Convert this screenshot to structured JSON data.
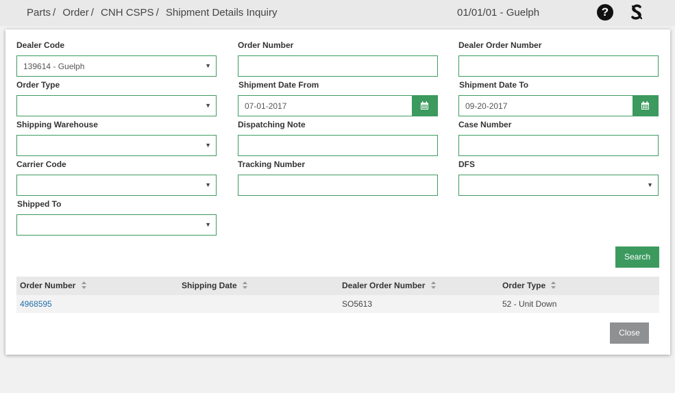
{
  "header": {
    "breadcrumb": [
      "Parts",
      "Order",
      "CNH CSPS",
      "Shipment Details Inquiry"
    ],
    "breadcrumb_separator": "/",
    "dealer_context": "01/01/01 - Guelph",
    "help_icon": "question-circle-icon",
    "brand_icon": "s-logo-icon"
  },
  "form": {
    "dealer_code": {
      "label": "Dealer Code",
      "value": "139614 - Guelph"
    },
    "order_number": {
      "label": "Order Number",
      "value": ""
    },
    "dealer_order_number": {
      "label": "Dealer Order Number",
      "value": ""
    },
    "order_type": {
      "label": "Order Type",
      "value": ""
    },
    "shipment_date_from": {
      "label": "Shipment Date From",
      "value": "07-01-2017"
    },
    "shipment_date_to": {
      "label": "Shipment Date To",
      "value": "09-20-2017"
    },
    "shipping_warehouse": {
      "label": "Shipping Warehouse",
      "value": ""
    },
    "dispatching_note": {
      "label": "Dispatching Note",
      "value": ""
    },
    "case_number": {
      "label": "Case Number",
      "value": ""
    },
    "carrier_code": {
      "label": "Carrier Code",
      "value": ""
    },
    "tracking_number": {
      "label": "Tracking Number",
      "value": ""
    },
    "dfs": {
      "label": "DFS",
      "value": ""
    },
    "shipped_to": {
      "label": "Shipped To",
      "value": ""
    }
  },
  "buttons": {
    "search": "Search",
    "close": "Close"
  },
  "results": {
    "columns": [
      "Order Number",
      "Shipping Date",
      "Dealer Order Number",
      "Order Type"
    ],
    "rows": [
      [
        "4968595",
        "",
        "SO5613",
        "52 - Unit Down"
      ]
    ]
  },
  "colors": {
    "accent_green": "#3c9a5f",
    "link_blue": "#1f6fa8",
    "close_gray": "#8e9091"
  }
}
